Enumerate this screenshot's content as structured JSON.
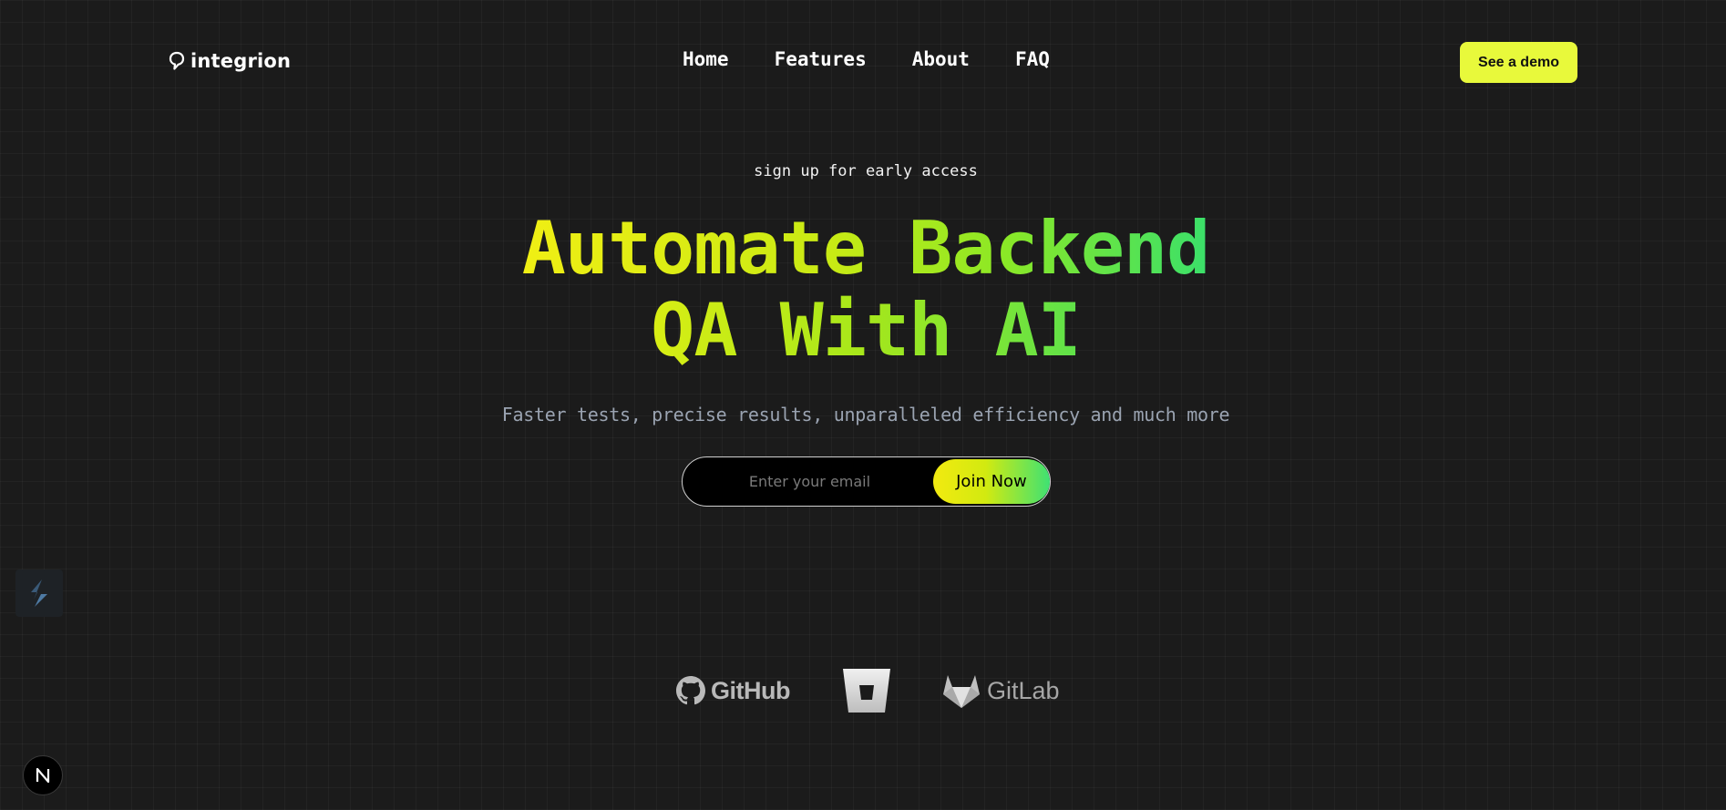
{
  "brand": {
    "name": "integrion",
    "logo_icon": "speech-bubble-icon"
  },
  "nav": {
    "items": [
      {
        "label": "Home"
      },
      {
        "label": "Features"
      },
      {
        "label": "About"
      },
      {
        "label": "FAQ"
      }
    ]
  },
  "header": {
    "cta_label": "See a demo"
  },
  "hero": {
    "eyebrow": "sign up for early access",
    "headline_line1": "Automate Backend",
    "headline_line2": "QA With AI",
    "subline": "Faster tests, precise results, unparalleled efficiency and much more"
  },
  "signup": {
    "email_placeholder": "Enter your email",
    "email_value": "",
    "join_label": "Join Now"
  },
  "integrations": [
    {
      "name": "GitHub",
      "icon": "github-icon"
    },
    {
      "name": "Bitbucket",
      "icon": "bitbucket-icon"
    },
    {
      "name": "GitLab",
      "icon": "gitlab-icon"
    }
  ],
  "overlays": {
    "side_widget_icon": "bolt-icon",
    "next_badge_letter": "N"
  },
  "colors": {
    "background": "#1b1b1b",
    "accent": "#e8f93b",
    "gradient_start": "#f0ef14",
    "gradient_end": "#3ae06a",
    "subtext": "#9aa3b1"
  }
}
